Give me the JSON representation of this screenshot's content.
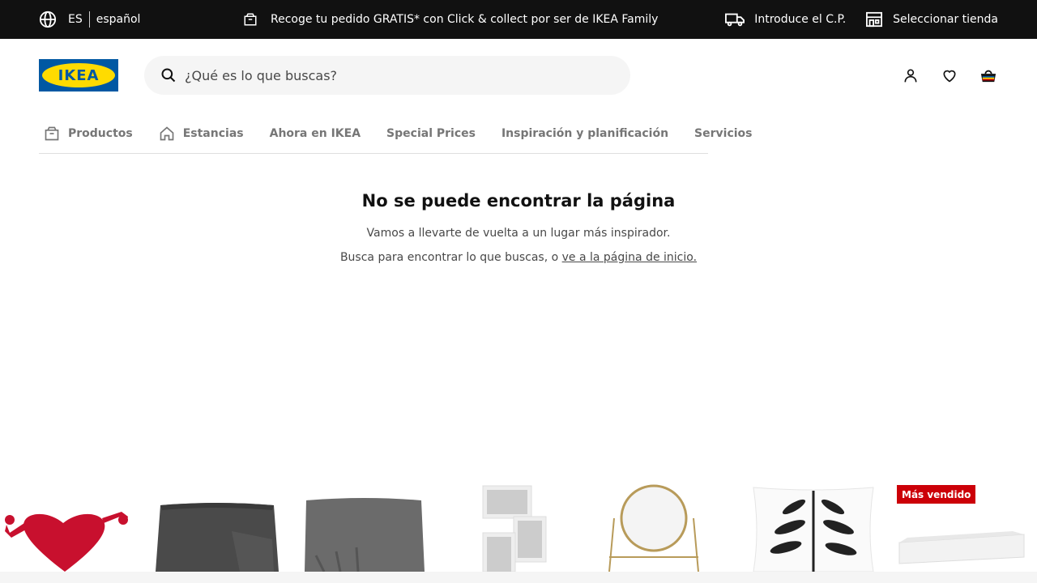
{
  "topbar": {
    "language_code": "ES",
    "language_name": "español",
    "promo": "Recoge tu pedido GRATIS* con Click & collect por ser de IKEA Family",
    "postal_code": "Introduce el C.P.",
    "store": "Seleccionar tienda"
  },
  "header": {
    "logo_text": "IKEA",
    "search_placeholder": "¿Qué es lo que buscas?"
  },
  "nav": {
    "items": [
      {
        "label": "Productos",
        "icon": "box-icon"
      },
      {
        "label": "Estancias",
        "icon": "house-icon"
      },
      {
        "label": "Ahora en IKEA"
      },
      {
        "label": "Special Prices"
      },
      {
        "label": "Inspiración y planificación"
      },
      {
        "label": "Servicios"
      }
    ]
  },
  "main": {
    "title": "No se puede encontrar la página",
    "line1": "Vamos a llevarte de vuelta a un lugar más inspirador.",
    "line2_prefix": "Busca para encontrar lo que buscas, o ",
    "line2_link": "ve a la página de inicio."
  },
  "products": {
    "badge": "Más vendido"
  },
  "colors": {
    "topbar_bg": "#111111",
    "ikea_blue": "#0058a3",
    "ikea_yellow": "#ffdb00",
    "badge_red": "#cc0008"
  }
}
